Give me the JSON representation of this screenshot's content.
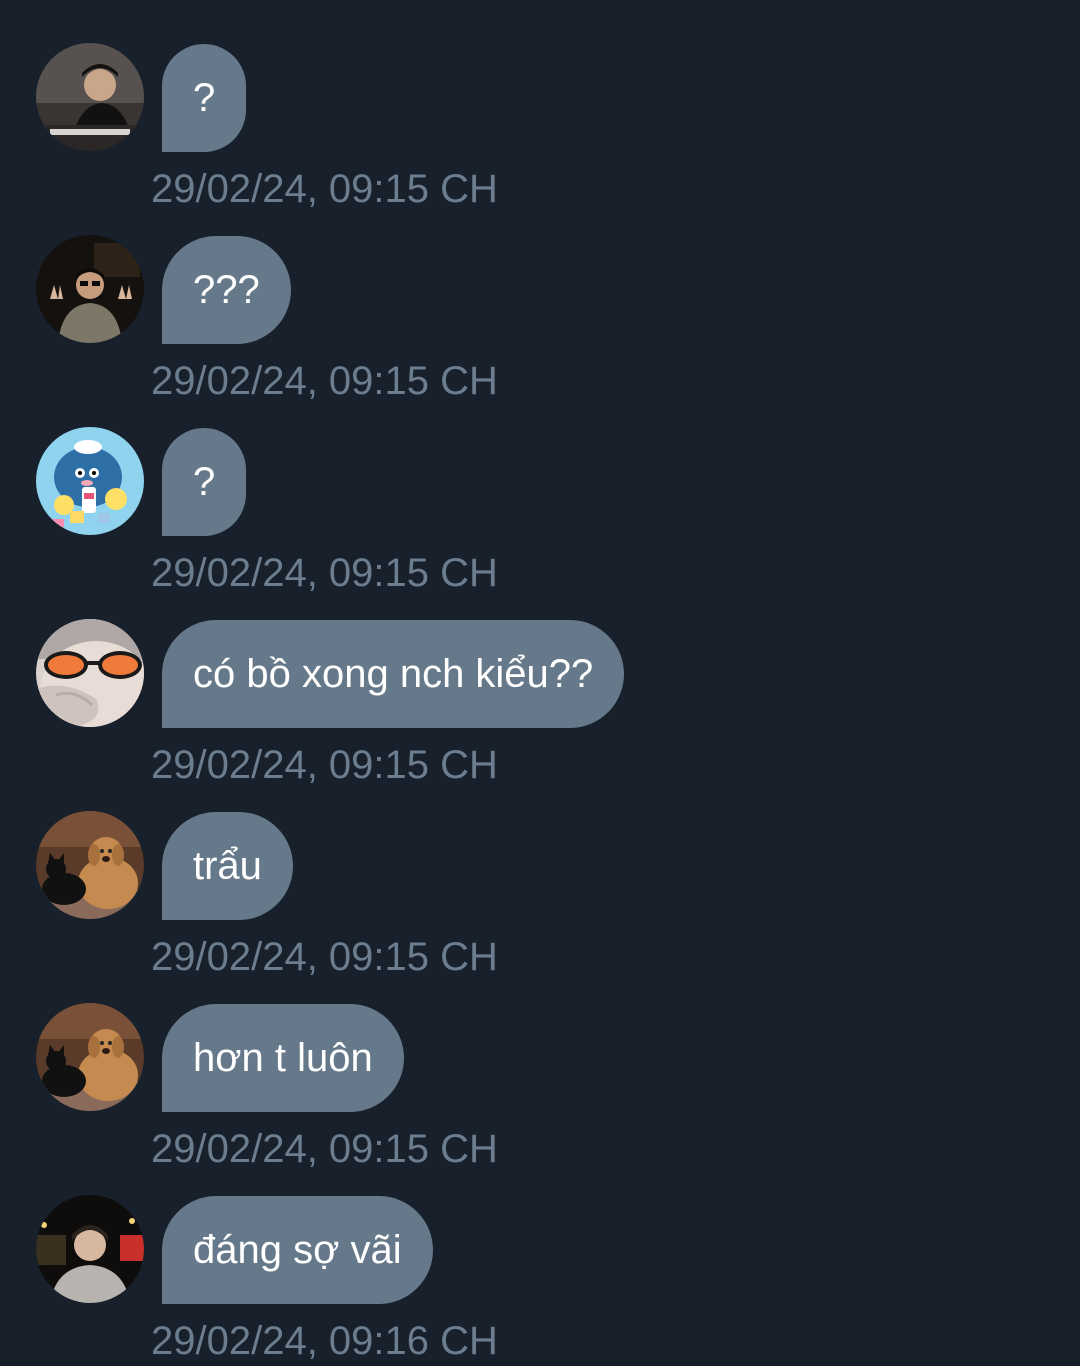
{
  "theme": {
    "background": "#17202b",
    "bubble": "#66798a",
    "bubble_text": "#ffffff",
    "timestamp": "#6b7d8e"
  },
  "messages": [
    {
      "avatar": "avatar-man-at-desk",
      "text": "?",
      "time": "29/02/24, 09:15 CH"
    },
    {
      "avatar": "avatar-man-sunglasses-peace-sign",
      "text": "???",
      "time": "29/02/24, 09:15 CH"
    },
    {
      "avatar": "avatar-cartoon-penguin",
      "text": "?",
      "time": "29/02/24, 09:15 CH"
    },
    {
      "avatar": "avatar-orange-sunglasses-selfie",
      "text": "có bồ xong nch kiểu??",
      "time": "29/02/24, 09:15 CH"
    },
    {
      "avatar": "avatar-dog-and-cat",
      "text": "trẩu",
      "time": "29/02/24, 09:15 CH"
    },
    {
      "avatar": "avatar-dog-and-cat",
      "text": "hơn t luôn",
      "time": "29/02/24, 09:15 CH"
    },
    {
      "avatar": "avatar-man-night-selfie",
      "text": "đáng sợ vãi",
      "time": "29/02/24, 09:16 CH"
    }
  ]
}
